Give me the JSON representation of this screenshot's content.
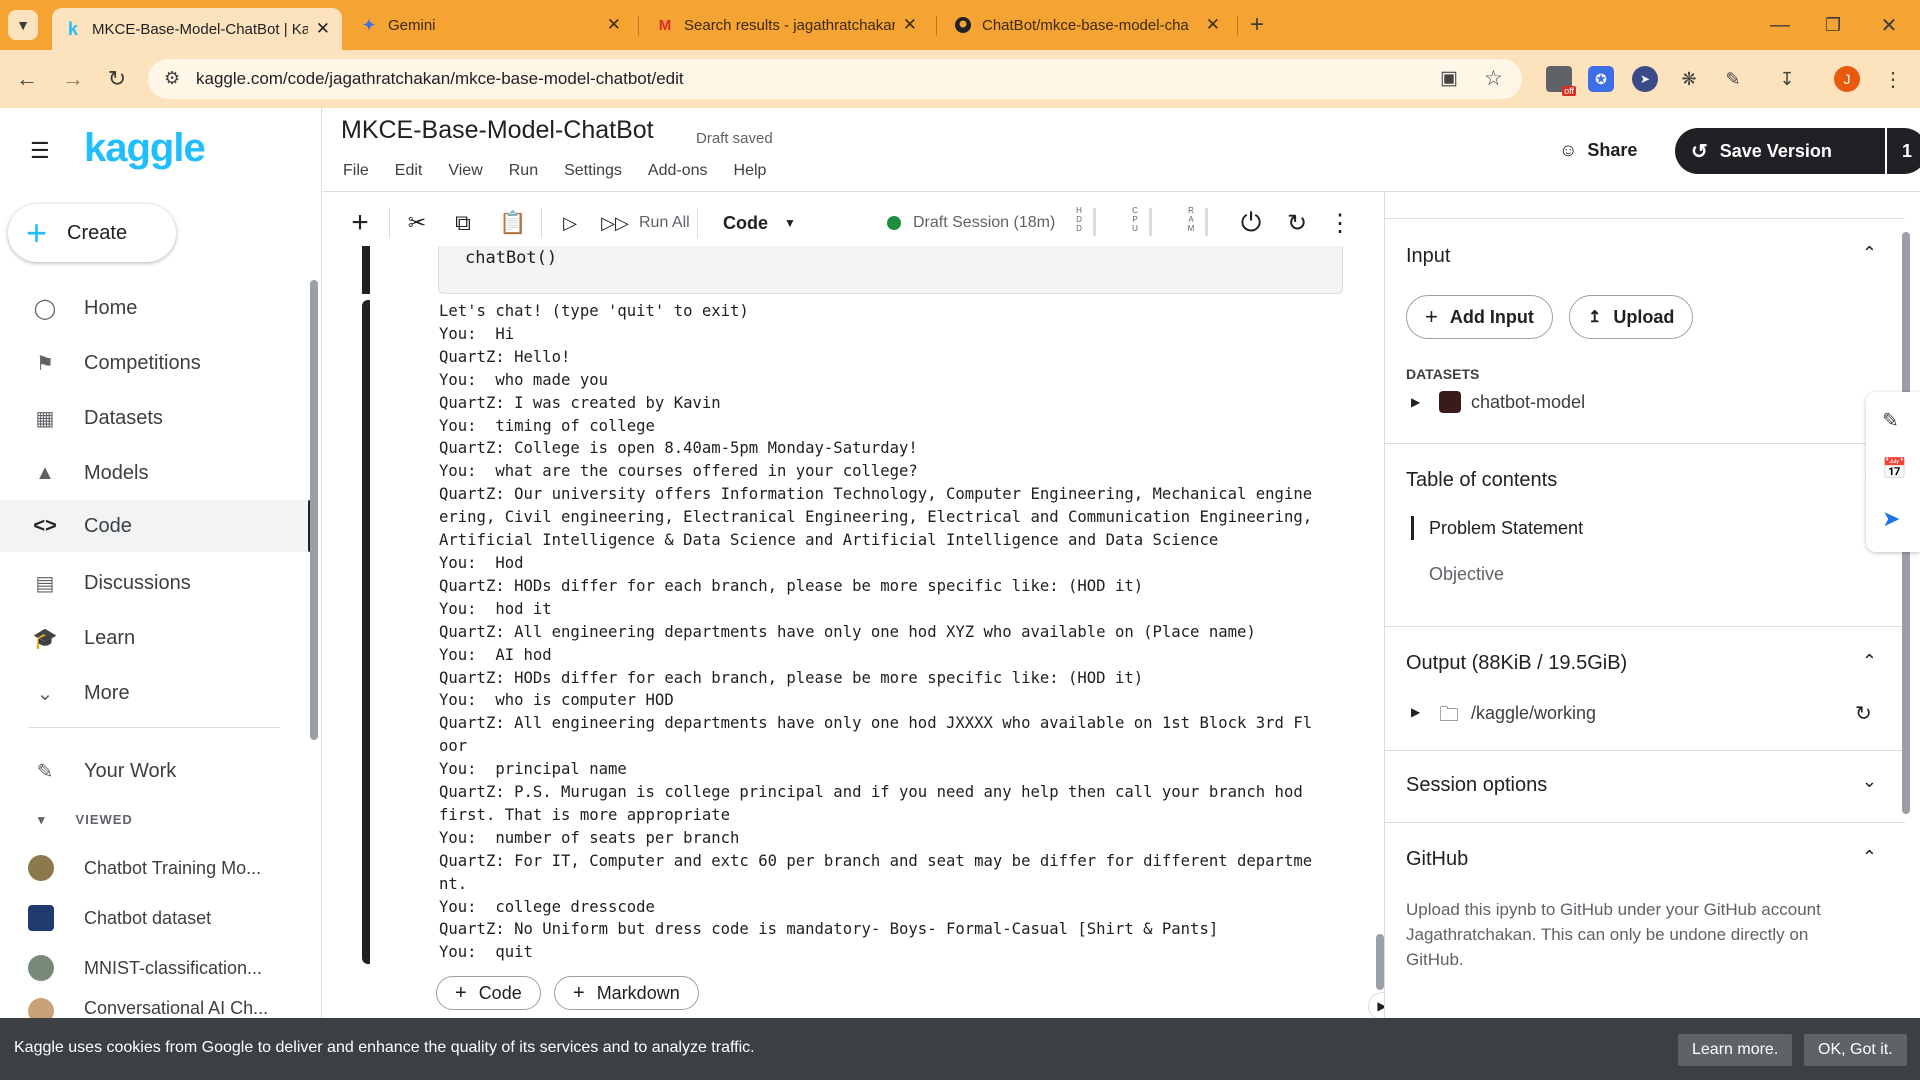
{
  "browser": {
    "tabs": [
      {
        "title": "MKCE-Base-Model-ChatBot | Ka",
        "icon": "kaggle-icon",
        "active": true
      },
      {
        "title": "Gemini",
        "icon": "gemini-icon",
        "active": false
      },
      {
        "title": "Search results - jagathratchakar",
        "icon": "gmail-icon",
        "active": false
      },
      {
        "title": "ChatBot/mkce-base-model-cha",
        "icon": "github-icon",
        "active": false
      }
    ],
    "url": "kaggle.com/code/jagathratchakan/mkce-base-model-chatbot/edit",
    "profile_initial": "J",
    "extension_badge": "off"
  },
  "sidebar": {
    "logo": "kaggle",
    "create_label": "Create",
    "items": [
      {
        "label": "Home",
        "icon": "compass-icon"
      },
      {
        "label": "Competitions",
        "icon": "trophy-icon"
      },
      {
        "label": "Datasets",
        "icon": "table-icon"
      },
      {
        "label": "Models",
        "icon": "models-icon"
      },
      {
        "label": "Code",
        "icon": "code-icon",
        "active": true
      },
      {
        "label": "Discussions",
        "icon": "discussion-icon"
      },
      {
        "label": "Learn",
        "icon": "learn-icon"
      },
      {
        "label": "More",
        "icon": "chevron-down-icon"
      }
    ],
    "your_work": "Your Work",
    "viewed_label": "VIEWED",
    "viewed": [
      "Chatbot Training Mo...",
      "Chatbot dataset",
      "MNIST-classification...",
      "Conversational AI Ch..."
    ]
  },
  "notebook": {
    "title": "MKCE-Base-Model-ChatBot",
    "status": "Draft saved",
    "menu": [
      "File",
      "Edit",
      "View",
      "Run",
      "Settings",
      "Add-ons",
      "Help"
    ],
    "share": "Share",
    "save_version": "Save Version",
    "save_count": "1",
    "run_all": "Run All",
    "cell_type": "Code",
    "session": "Draft Session (18m)",
    "meters": [
      "H D D",
      "C P U",
      "R A M"
    ],
    "code_line": "chatBot()",
    "output_lines": [
      "Let's chat! (type 'quit' to exit)",
      "You:  Hi",
      "QuartZ: Hello!",
      "You:  who made you",
      "QuartZ: I was created by Kavin",
      "You:  timing of college",
      "QuartZ: College is open 8.40am-5pm Monday-Saturday!",
      "You:  what are the courses offered in your college?",
      "QuartZ: Our university offers Information Technology, Computer Engineering, Mechanical engine",
      "ering, Civil engineering, Electranical Engineering, Electrical and Communication Engineering,",
      "Artificial Intelligence & Data Science and Artificial Intelligence and Data Science",
      "You:  Hod",
      "QuartZ: HODs differ for each branch, please be more specific like: (HOD it)",
      "You:  hod it",
      "QuartZ: All engineering departments have only one hod XYZ who available on (Place name)",
      "You:  AI hod",
      "QuartZ: HODs differ for each branch, please be more specific like: (HOD it)",
      "You:  who is computer HOD",
      "QuartZ: All engineering departments have only one hod JXXXX who available on 1st Block 3rd Fl",
      "oor",
      "You:  principal name",
      "QuartZ: P.S. Murugan is college principal and if you need any help then call your branch hod",
      "first. That is more appropriate",
      "You:  number of seats per branch",
      "QuartZ: For IT, Computer and extc 60 per branch and seat may be differ for different departme",
      "nt.",
      "You:  college dresscode",
      "QuartZ: No Uniform but dress code is mandatory- Boys- Formal-Casual [Shirt & Pants]",
      "You:  quit"
    ],
    "add_code": "Code",
    "add_markdown": "Markdown"
  },
  "panel": {
    "input_title": "Input",
    "add_input": "Add Input",
    "upload": "Upload",
    "datasets_label": "DATASETS",
    "dataset_name": "chatbot-model",
    "toc_title": "Table of contents",
    "toc_items": [
      "Problem Statement",
      "Objective"
    ],
    "output_title": "Output (88KiB / 19.5GiB)",
    "output_path": "/kaggle/working",
    "session_title": "Session options",
    "github_title": "GitHub",
    "github_text": "Upload this ipynb to GitHub under your GitHub account Jagathratchakan. This can only be undone directly on GitHub."
  },
  "cookie": {
    "text": "Kaggle uses cookies from Google to deliver and enhance the quality of its services and to analyze traffic.",
    "learn_more": "Learn more.",
    "ok": "OK, Got it."
  },
  "colors": {
    "kaggle_blue": "#20beff",
    "tabbar": "#f5a433",
    "addressbar": "#fde3bd",
    "session_green": "#1e8e3e"
  }
}
